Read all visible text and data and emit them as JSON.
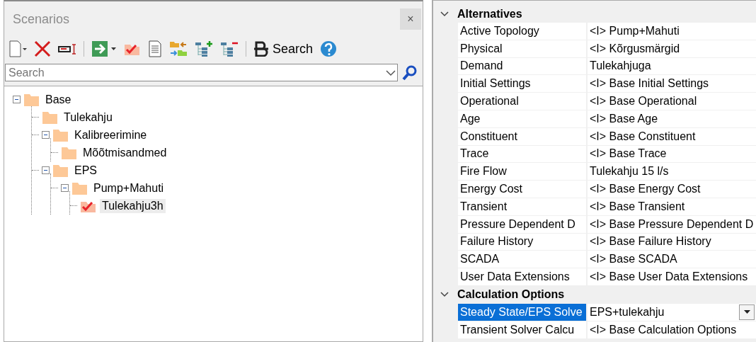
{
  "scenarios_panel": {
    "title": "Scenarios",
    "close": "×",
    "toolbar": {
      "search_button": "Search"
    },
    "search": {
      "placeholder": "Search"
    },
    "tree": [
      {
        "label": "Base",
        "kind": "folder",
        "expanded": true,
        "selected": false,
        "children": [
          {
            "label": "Tulekahju",
            "kind": "folder",
            "selected": false
          },
          {
            "label": "Kalibreerimine",
            "kind": "folder",
            "expanded": true,
            "selected": false,
            "children": [
              {
                "label": "Mõõtmisandmed",
                "kind": "folder",
                "selected": false
              }
            ]
          },
          {
            "label": "EPS",
            "kind": "folder",
            "expanded": true,
            "selected": false,
            "children": [
              {
                "label": "Pump+Mahuti",
                "kind": "folder",
                "expanded": true,
                "selected": false,
                "children": [
                  {
                    "label": "Tulekahju3h",
                    "kind": "active",
                    "selected": true
                  }
                ]
              }
            ]
          }
        ]
      }
    ]
  },
  "properties": [
    {
      "category": "Alternatives",
      "expanded": true,
      "rows": [
        {
          "name": "Active Topology",
          "value": "<I> Pump+Mahuti",
          "kind": "text",
          "selected": false
        },
        {
          "name": "Physical",
          "value": "<I> Kõrgusmärgid",
          "kind": "text",
          "selected": false
        },
        {
          "name": "Demand",
          "value": "Tulekahjuga",
          "kind": "text",
          "selected": false
        },
        {
          "name": "Initial Settings",
          "value": "<I> Base Initial Settings",
          "kind": "text",
          "selected": false
        },
        {
          "name": "Operational",
          "value": "<I> Base Operational",
          "kind": "text",
          "selected": false
        },
        {
          "name": "Age",
          "value": "<I> Base Age",
          "kind": "text",
          "selected": false
        },
        {
          "name": "Constituent",
          "value": "<I> Base Constituent",
          "kind": "text",
          "selected": false
        },
        {
          "name": "Trace",
          "value": "<I> Base Trace",
          "kind": "text",
          "selected": false
        },
        {
          "name": "Fire Flow",
          "value": "Tulekahju 15 l/s",
          "kind": "text",
          "selected": false
        },
        {
          "name": "Energy Cost",
          "value": "<I> Base Energy Cost",
          "kind": "text",
          "selected": false
        },
        {
          "name": "Transient",
          "value": "<I> Base Transient",
          "kind": "text",
          "selected": false
        },
        {
          "name": "Pressure Dependent D",
          "value": "<I> Base Pressure Dependent D",
          "kind": "text",
          "selected": false
        },
        {
          "name": "Failure History",
          "value": "<I> Base Failure History",
          "kind": "text",
          "selected": false
        },
        {
          "name": "SCADA",
          "value": "<I> Base SCADA",
          "kind": "text",
          "selected": false
        },
        {
          "name": "User Data Extensions",
          "value": "<I> Base User Data Extensions",
          "kind": "text",
          "selected": false
        }
      ]
    },
    {
      "category": "Calculation Options",
      "expanded": true,
      "rows": [
        {
          "name": "Steady State/EPS Solve",
          "value": "EPS+tulekahju",
          "kind": "dropdown",
          "selected": true
        },
        {
          "name": "Transient Solver Calcu",
          "value": "<I> Base Calculation Options",
          "kind": "text",
          "selected": false
        }
      ]
    }
  ]
}
